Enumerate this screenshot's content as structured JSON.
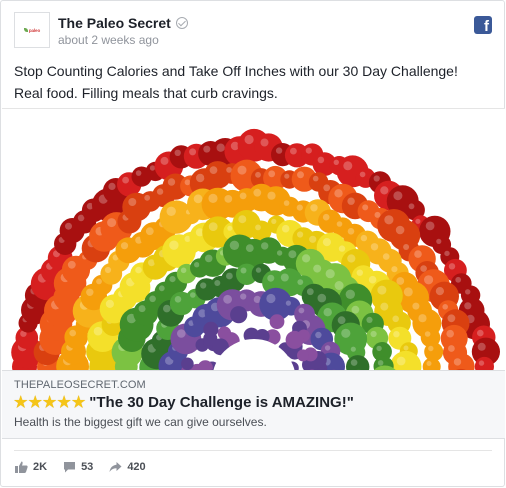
{
  "post": {
    "page_name": "The Paleo Secret",
    "timestamp": "about 2 weeks ago",
    "avatar_text": "paleo",
    "lines": [
      "Stop Counting Calories and Take Off Inches with our 30 Day Challenge!",
      "Real food. Filling meals that curb cravings."
    ],
    "image_icon": "rainbow-fruits-vegetables"
  },
  "link": {
    "domain": "THEPALEOSECRET.COM",
    "star_count": 5,
    "title": "\"The 30 Day Challenge is AMAZING!\"",
    "description": "Health is the biggest gift we can give ourselves."
  },
  "stats": {
    "likes": "2K",
    "comments": "53",
    "shares": "420"
  },
  "colors": {
    "facebook_blue": "#3b5998",
    "star_gold": "#f5c518",
    "text": "#1d2129",
    "muted": "#90949c"
  }
}
